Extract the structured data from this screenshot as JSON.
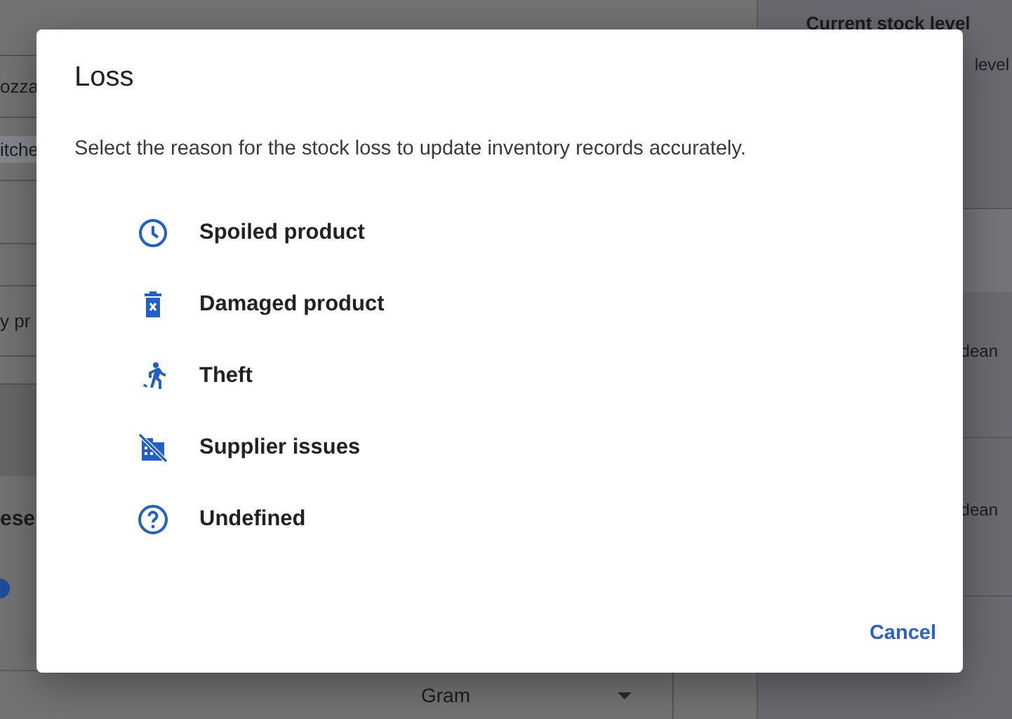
{
  "background": {
    "left_items": [
      {
        "text": "ozza",
        "kind": "cell"
      },
      {
        "text": "itche",
        "kind": "chip"
      },
      {
        "text": "y pr",
        "kind": "cell"
      }
    ],
    "section_title": "ese",
    "unit_select": {
      "value": "Gram"
    },
    "right_panel": {
      "title": "Current stock level",
      "subtitle": "level",
      "cards": [
        "dean",
        "dean"
      ]
    }
  },
  "dialog": {
    "title": "Loss",
    "message": "Select the reason for the stock loss to update inventory records accurately.",
    "options": [
      {
        "label": "Spoiled product",
        "kind": "spoiled"
      },
      {
        "label": "Damaged product",
        "kind": "damaged"
      },
      {
        "label": "Theft",
        "kind": "theft"
      },
      {
        "label": "Supplier issues",
        "kind": "supplier"
      },
      {
        "label": "Undefined",
        "kind": "undefined"
      }
    ],
    "buttons": [
      "Cancel"
    ]
  }
}
